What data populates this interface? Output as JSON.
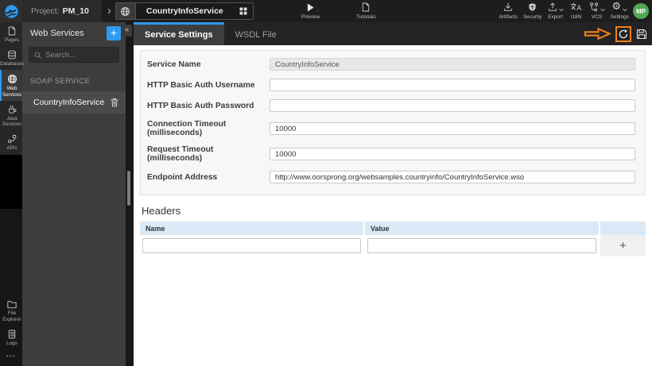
{
  "colors": {
    "accent_blue": "#2E9BF0",
    "annotation_orange": "#EF7F1A",
    "avatar_green": "#53A653",
    "table_header_blue": "#D9E9F7"
  },
  "topbar": {
    "project_label": "Project:",
    "project_name": "PM_10",
    "breadcrumb_chevron": "›",
    "service_widget_name": "CountryInfoService",
    "preview_label": "Preview",
    "tutorials_label": "Tutorials",
    "menu_labels": [
      "Artifacts",
      "Security",
      "Export",
      "I18N",
      "VCS",
      "Settings"
    ],
    "avatar_initials": "MP"
  },
  "sidebar": {
    "items": [
      "Pages",
      "Databases",
      "Web Services",
      "Java Services",
      "APIs"
    ],
    "bottom_items": [
      "File Explorer",
      "Logs"
    ],
    "more": "•••"
  },
  "panel": {
    "title": "Web Services",
    "add_button": "+",
    "collapse_button": "«",
    "search_placeholder": "Search...",
    "section_label": "SOAP SERVICE",
    "services": [
      {
        "name": "CountryInfoService",
        "selected": true
      }
    ]
  },
  "tabs": [
    {
      "label": "Service Settings",
      "active": true
    },
    {
      "label": "WSDL File",
      "active": false
    }
  ],
  "form": {
    "fields": [
      {
        "label": "Service Name",
        "value": "CountryInfoService",
        "disabled": true
      },
      {
        "label": "HTTP Basic Auth Username",
        "value": ""
      },
      {
        "label": "HTTP Basic Auth Password",
        "value": ""
      },
      {
        "label": "Connection Timeout (milliseconds)",
        "value": "10000"
      },
      {
        "label": "Request Timeout (milliseconds)",
        "value": "10000"
      },
      {
        "label": "Endpoint Address",
        "value": "http://www.oorsprong.org/websamples.countryinfo/CountryInfoService.wso"
      }
    ]
  },
  "headers_section": {
    "title": "Headers",
    "columns": [
      "Name",
      "Value"
    ],
    "add_button": "+",
    "rows": [
      {
        "name": "",
        "value": ""
      }
    ]
  }
}
